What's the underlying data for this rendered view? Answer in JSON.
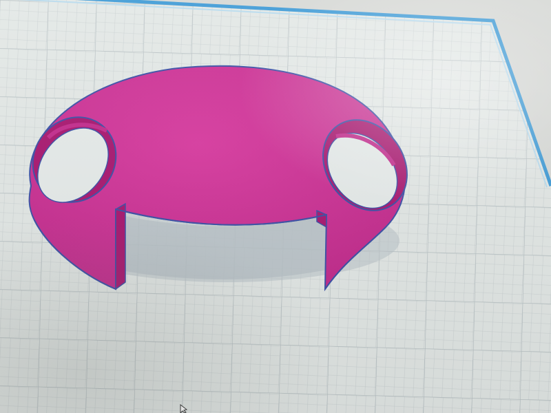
{
  "app": {
    "view": "3d-workplane"
  },
  "workplane": {
    "grid": true,
    "plane_color": "#e3e8e6",
    "grid_line_color": "#c3cbcd",
    "grid_major_color": "#b3bdc0",
    "edge_color": "#3f9bd6",
    "outside_color": "#d6d8d5"
  },
  "model": {
    "shape": "half-dome-cap-with-side-holes-and-front-slot",
    "fill_color": "#cc2f95",
    "rim_color": "#b2207f",
    "inner_color": "#a8166f",
    "outline_color": "#3b4fa6",
    "shadow_color": "#b9c3c9"
  },
  "cursor": {
    "icon": "arrow-cursor-icon"
  }
}
